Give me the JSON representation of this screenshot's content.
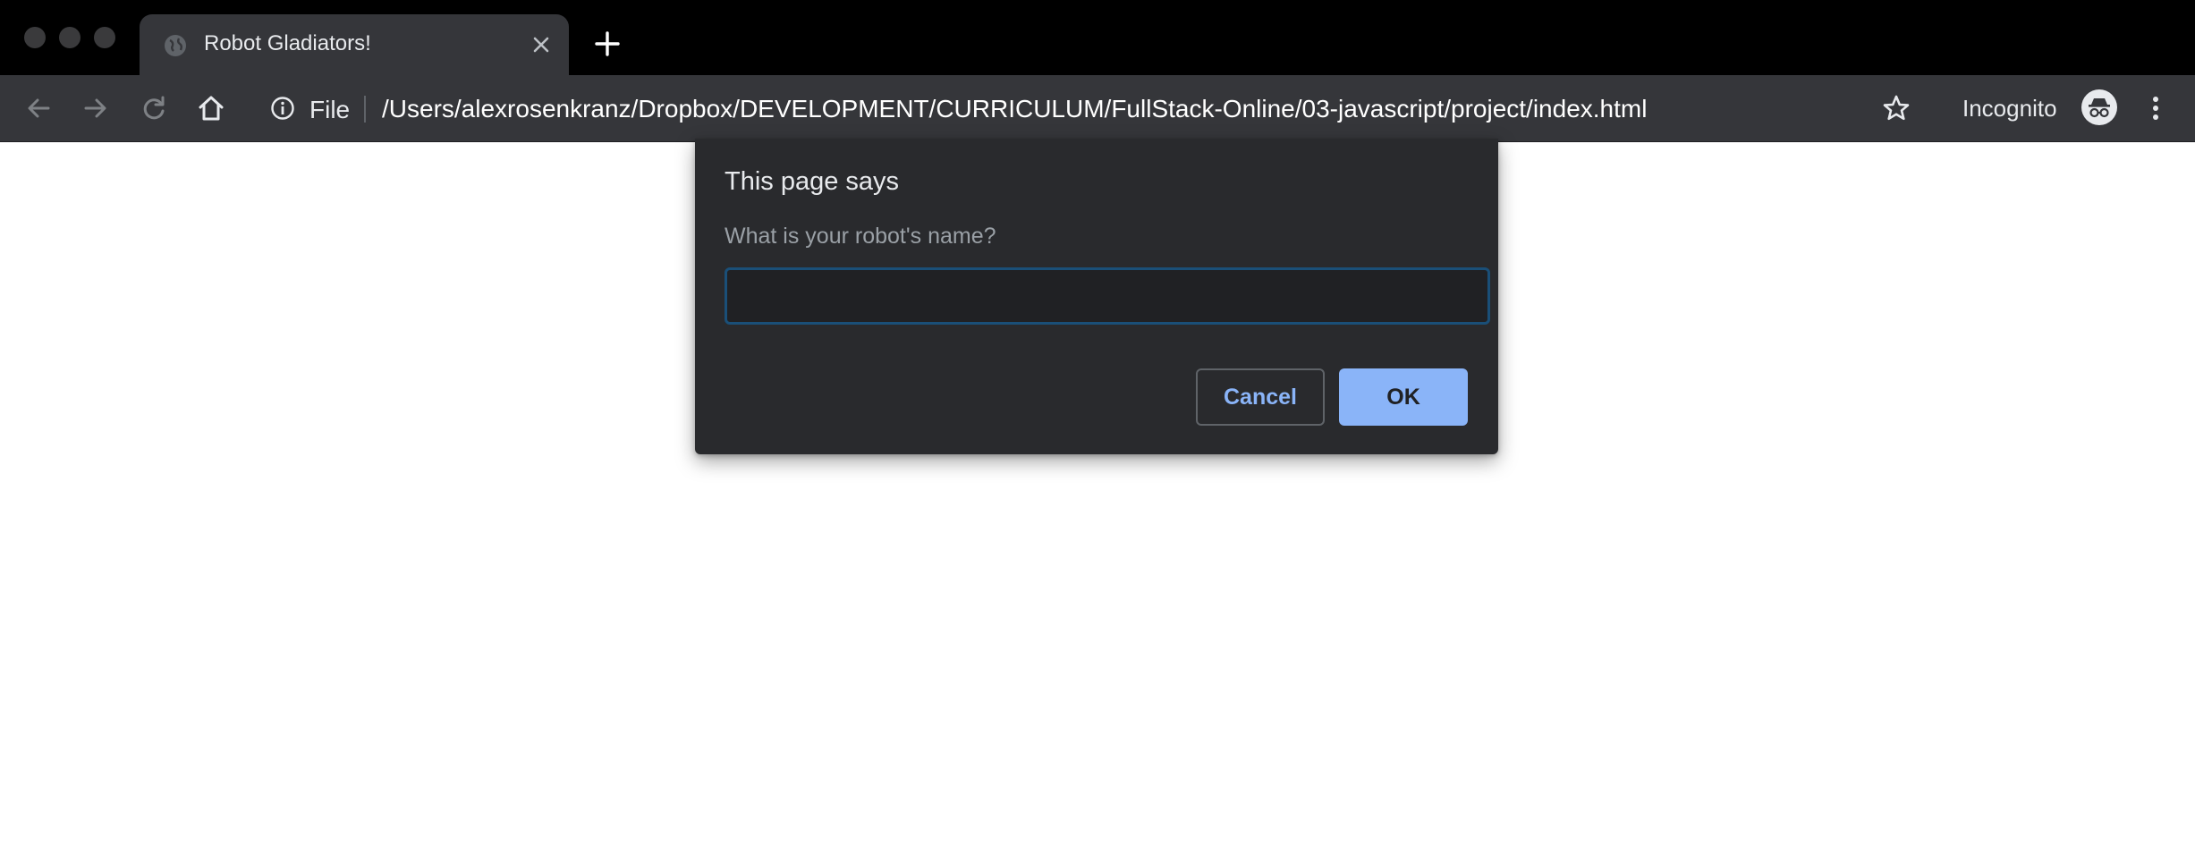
{
  "tab": {
    "title": "Robot Gladiators!",
    "favicon": "globe-icon"
  },
  "toolbar": {
    "back_icon": "back-arrow-icon",
    "forward_icon": "forward-arrow-icon",
    "reload_icon": "reload-icon",
    "home_icon": "home-icon"
  },
  "omnibox": {
    "scheme_label": "File",
    "url": "/Users/alexrosenkranz/Dropbox/DEVELOPMENT/CURRICULUM/FullStack-Online/03-javascript/project/index.html"
  },
  "profile": {
    "label": "Incognito"
  },
  "dialog": {
    "title": "This page says",
    "message": "What is your robot's name?",
    "input_value": "",
    "cancel_label": "Cancel",
    "ok_label": "OK"
  },
  "colors": {
    "tabstrip_bg": "#000000",
    "toolbar_bg": "#35363a",
    "dialog_bg": "#292a2d",
    "accent_blue": "#8ab4f8",
    "input_border": "#1a4f78",
    "page_bg": "#ffffff"
  }
}
